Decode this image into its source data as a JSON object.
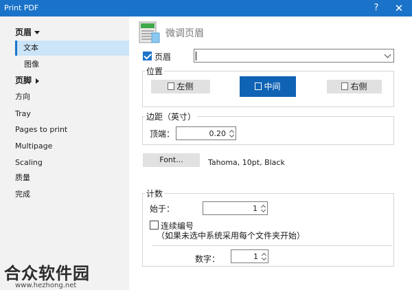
{
  "window": {
    "title": "Print PDF",
    "help": "?",
    "close": "✕"
  },
  "sidebar": {
    "items": [
      {
        "label": "页眉"
      },
      {
        "label": "文本"
      },
      {
        "label": "图像"
      },
      {
        "label": "页脚"
      },
      {
        "label": "方向"
      },
      {
        "label": "Tray"
      },
      {
        "label": "Pages to print"
      },
      {
        "label": "Multipage"
      },
      {
        "label": "Scaling"
      },
      {
        "label": "质量"
      },
      {
        "label": "完成"
      }
    ]
  },
  "main": {
    "header_title": "微调页眉",
    "header_checkbox": {
      "label": "页眉",
      "checked": true
    },
    "header_text_value": "",
    "position": {
      "legend": "位置",
      "left_label": "左侧",
      "center_label": "中间",
      "right_label": "右侧",
      "selected": "中间"
    },
    "margin": {
      "legend": "边距（英寸）",
      "top_label": "顶端：",
      "top_value": "0.20"
    },
    "font": {
      "button_label": "Font...",
      "description": "Tahoma, 10pt, Black"
    },
    "count": {
      "legend": "计数",
      "start_label": "始于：",
      "start_value": "1",
      "continuous_label": "连续编号",
      "continuous_checked": false,
      "continuous_note": "（如果未选中系统采用每个文件夹开始）",
      "digits_label": "数字：",
      "digits_value": "1"
    }
  },
  "watermark": {
    "text": "合众软件园",
    "url": "www.hezhong.net"
  }
}
